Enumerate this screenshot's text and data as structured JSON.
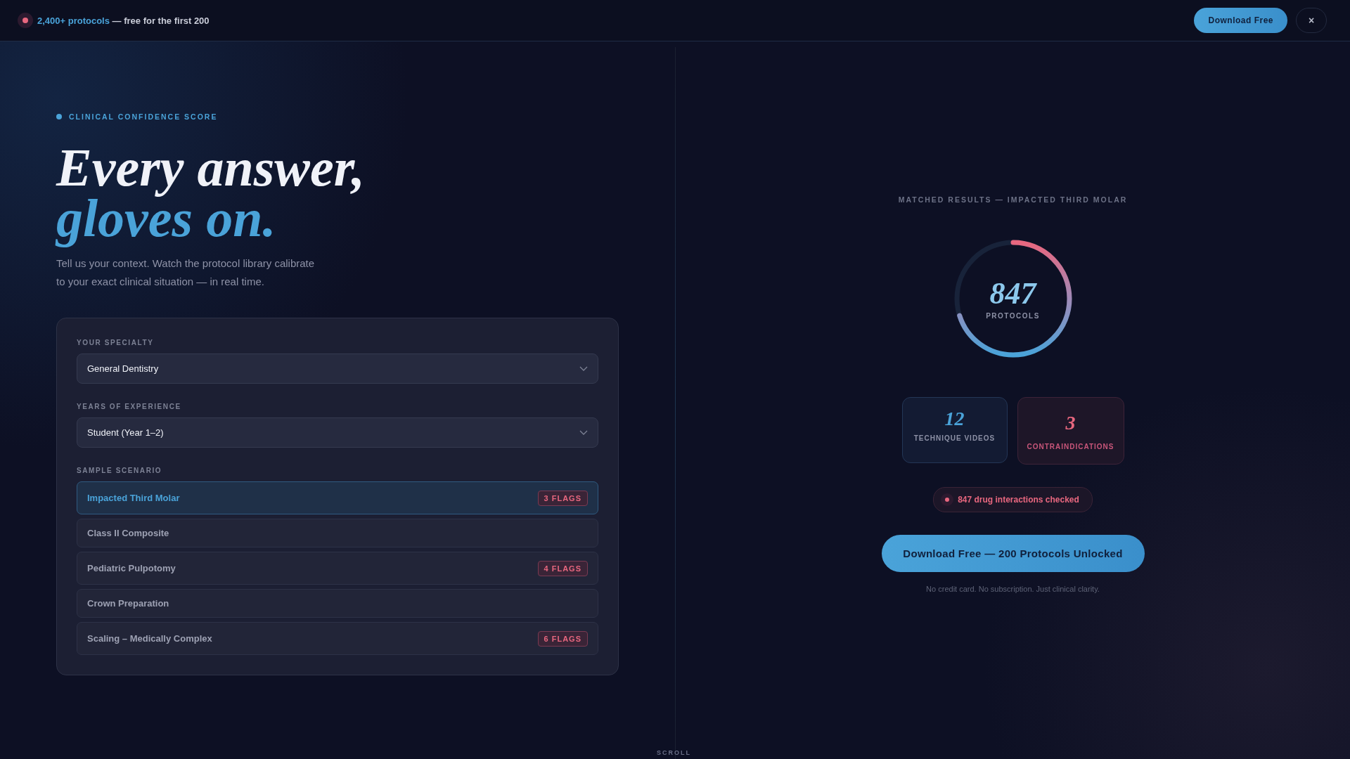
{
  "banner": {
    "highlight": "2,400+ protocols",
    "text": "— free for the first 200",
    "download_button": "Download Free",
    "close_button": "×"
  },
  "hero": {
    "eyebrow": "CLINICAL CONFIDENCE SCORE",
    "title_line_1": "Every answer,",
    "title_line_2": "gloves on.",
    "description_line_1": "Tell us your context. Watch the protocol library calibrate",
    "description_line_2": "to your exact clinical situation — in real time."
  },
  "form": {
    "specialty": {
      "label": "YOUR SPECIALTY",
      "value": "General Dentistry"
    },
    "experience": {
      "label": "YEARS OF EXPERIENCE",
      "value": "Student (Year 1–2)"
    },
    "scenario_label": "SAMPLE SCENARIO",
    "scenarios": [
      {
        "name": "Impacted Third Molar",
        "flags": "3 FLAGS",
        "selected": true
      },
      {
        "name": "Class II Composite",
        "selected": false
      },
      {
        "name": "Pediatric Pulpotomy",
        "flags": "4 FLAGS",
        "selected": false
      },
      {
        "name": "Crown Preparation",
        "selected": false
      },
      {
        "name": "Scaling – Medically Complex",
        "flags": "6 FLAGS",
        "selected": false
      }
    ]
  },
  "results": {
    "title": "MATCHED RESULTS — IMPACTED THIRD MOLAR",
    "gauge": {
      "value": "847",
      "label": "PROTOCOLS",
      "level": 0.7
    },
    "stats": [
      {
        "value": "12",
        "label": "TECHNIQUE VIDEOS",
        "kind": "info"
      },
      {
        "value": "3",
        "label": "CONTRAINDICATIONS",
        "kind": "warning"
      }
    ],
    "interactions": "847 drug interactions checked",
    "cta": "Download Free — 200 Protocols Unlocked",
    "note": "No credit card. No subscription. Just clinical clarity."
  },
  "scroll_hint": "SCROLL"
}
